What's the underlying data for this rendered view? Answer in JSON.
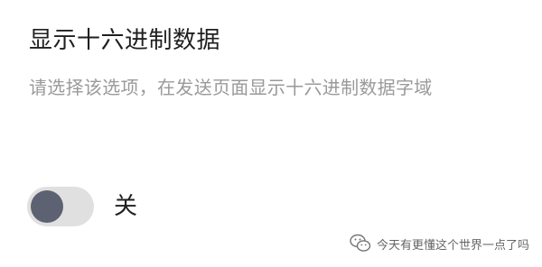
{
  "setting": {
    "title": "显示十六进制数据",
    "description": "请选择该选项，在发送页面显示十六进制数据字域",
    "toggle": {
      "state": "off",
      "label": "关",
      "track_color": "#e0e0e0",
      "knob_color": "#5d6272"
    }
  },
  "watermark": {
    "icon": "wechat-icon",
    "text": "今天有更懂这个世界一点了吗"
  }
}
